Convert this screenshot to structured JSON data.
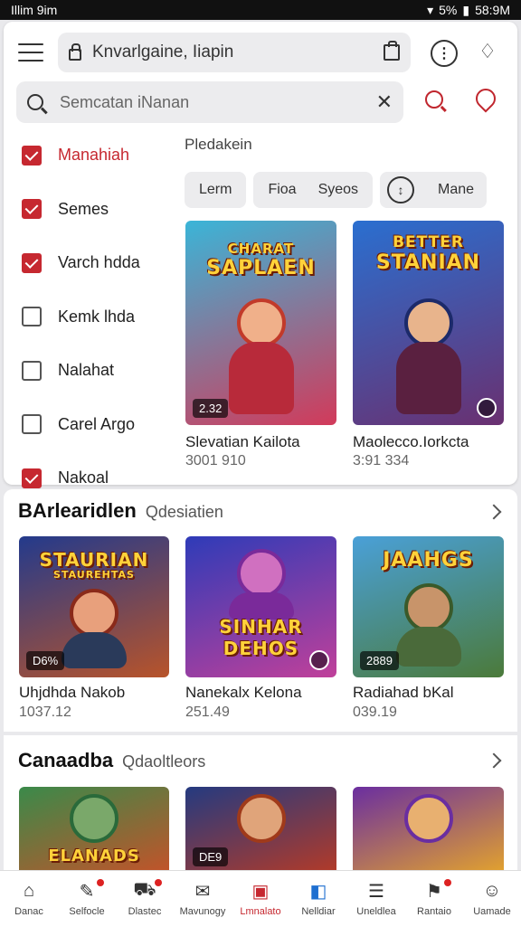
{
  "status": {
    "time": "Illim 9im",
    "battery": "5%",
    "clock": "58:9M"
  },
  "header": {
    "url": "Knvarlgaine, Iiapin"
  },
  "search": {
    "placeholder": "Semcatan iNanan"
  },
  "filters": [
    {
      "label": "Manahiah",
      "checked": true,
      "active": true
    },
    {
      "label": "Semes",
      "checked": true,
      "active": false
    },
    {
      "label": "Varch hdda",
      "checked": true,
      "active": false
    },
    {
      "label": "Kemk lhda",
      "checked": false,
      "active": false
    },
    {
      "label": "Nalahat",
      "checked": false,
      "active": false
    },
    {
      "label": "Carel Argo",
      "checked": false,
      "active": false
    },
    {
      "label": "Nakoal",
      "checked": true,
      "active": false
    }
  ],
  "sort": {
    "label": "Pledakein"
  },
  "chips": {
    "c1": "Lerm",
    "c2a": "Fioa",
    "c2b": "Syeos",
    "c3": "Mane"
  },
  "featured": [
    {
      "title": "Slevatian Kailota",
      "price": "3001 910",
      "art_title": "SAPLAEN",
      "art_sub": "CHARAT",
      "badge": "2.32",
      "colors": [
        "#3ab5d8",
        "#d23a5a"
      ]
    },
    {
      "title": "Maolecco.Iorkcta",
      "price": "3:91 334",
      "art_title": "STANIAN",
      "art_sub": "BETTER",
      "badge": "",
      "colors": [
        "#2a6fd0",
        "#6a3070"
      ]
    }
  ],
  "sections": [
    {
      "title": "BArlearidlen",
      "subtitle": "Qdesiatien",
      "items": [
        {
          "title": "Uhjdhda Nakob",
          "price": "1037.12",
          "art_title": "STAURIAN",
          "art_sub": "STAUREHTAS",
          "badge": "D6%",
          "colors": [
            "#233a8c",
            "#b8542a"
          ]
        },
        {
          "title": "Nanekalx Kelona",
          "price": "251.49",
          "art_title": "SINHAR DEHOS",
          "art_sub": "",
          "badge": "",
          "colors": [
            "#2e3bb8",
            "#c0409a"
          ]
        },
        {
          "title": "Radiahad bKal",
          "price": "039.19",
          "art_title": "JAAHGS",
          "art_sub": "",
          "badge": "2889",
          "colors": [
            "#4aa0d8",
            "#4b7a3a"
          ]
        }
      ]
    },
    {
      "title": "Canaadba",
      "subtitle": "Qdaoltleors",
      "items": [
        {
          "title": "",
          "price": "",
          "art_title": "ELANADS",
          "art_sub": "",
          "badge": "",
          "colors": [
            "#3a8a4a",
            "#c0542a"
          ]
        },
        {
          "title": "",
          "price": "",
          "art_title": "",
          "art_sub": "",
          "badge": "DE9",
          "colors": [
            "#243a80",
            "#b03a2a"
          ]
        },
        {
          "title": "",
          "price": "",
          "art_title": "",
          "art_sub": "",
          "badge": "",
          "colors": [
            "#6a2ea0",
            "#e0a030"
          ]
        }
      ]
    }
  ],
  "tabs": [
    {
      "label": "Danac",
      "icon": "⌂",
      "active": false,
      "dot": false
    },
    {
      "label": "Selfocle",
      "icon": "✎",
      "active": false,
      "dot": true
    },
    {
      "label": "Dlastec",
      "icon": "⛟",
      "active": false,
      "dot": true
    },
    {
      "label": "Mavunogy",
      "icon": "✉",
      "active": false,
      "dot": false
    },
    {
      "label": "Lmnalato",
      "icon": "▣",
      "active": true,
      "dot": false
    },
    {
      "label": "Nelldiar",
      "icon": "◧",
      "active": false,
      "dot": false
    },
    {
      "label": "Uneldlea",
      "icon": "☰",
      "active": false,
      "dot": false
    },
    {
      "label": "Rantaio",
      "icon": "⚑",
      "active": false,
      "dot": true
    },
    {
      "label": "Uamade",
      "icon": "☺",
      "active": false,
      "dot": false
    }
  ],
  "accent_color": "#c62830"
}
